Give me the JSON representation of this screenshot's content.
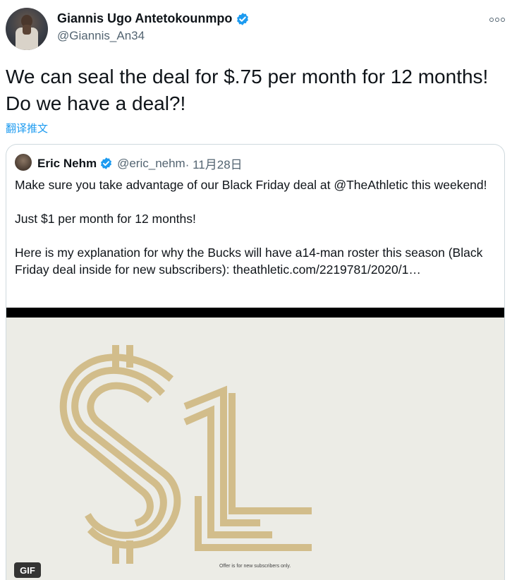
{
  "author": {
    "name": "Giannis Ugo Antetokounmpo",
    "handle": "@Giannis_An34"
  },
  "tweet": {
    "text": "We can seal the deal for $.75 per month for 12 months! Do we have a deal?!",
    "translate_label": "翻译推文"
  },
  "quoted": {
    "name": "Eric Nehm",
    "handle": "@eric_nehm",
    "date": "· 11月28日",
    "paragraphs": [
      "Make sure you take advantage of our Black Friday deal at @TheAthletic this weekend!",
      "Just $1 per month for 12 months!",
      "Here is my explanation for why the Bucks will have a14-man roster this season (Black Friday deal inside for new subscribers): theathletic.com/2219781/2020/1…"
    ],
    "media": {
      "badge": "GIF",
      "offer_text": "Offer is for new subscribers only.",
      "graphic_text": "$1",
      "graphic_color": "#d2bd8b"
    }
  },
  "colors": {
    "verified": "#1d9bf0",
    "link": "#1d9bf0",
    "secondary_text": "#536471"
  },
  "icons": {
    "verified": "verified-badge-icon",
    "more": "more-options-icon"
  }
}
